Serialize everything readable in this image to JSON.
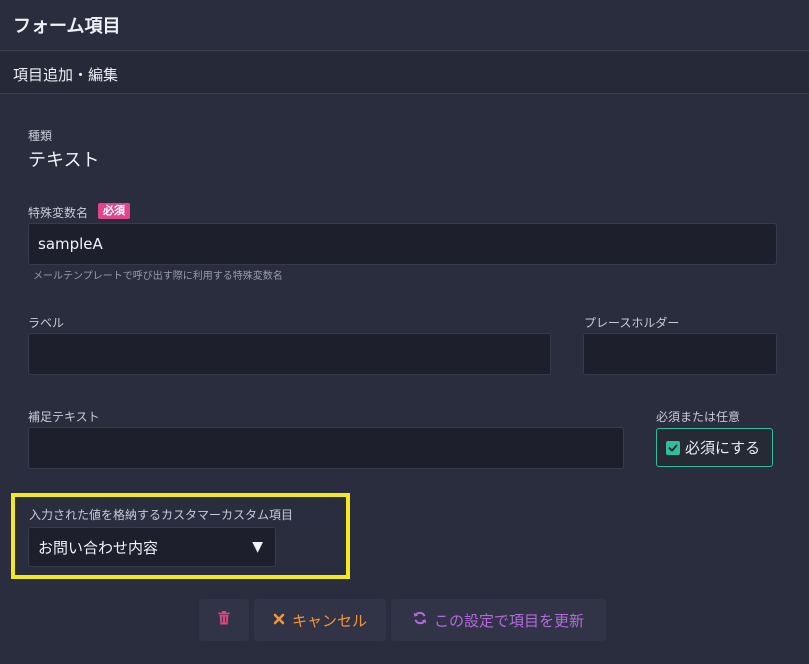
{
  "header": {
    "title": "フォーム項目"
  },
  "subheader": {
    "title": "項目追加・編集"
  },
  "type_field": {
    "label": "種類",
    "value": "テキスト"
  },
  "variable_field": {
    "label": "特殊変数名",
    "required_badge": "必須",
    "value": "sampleA",
    "hint": "メールテンプレートで呼び出す際に利用する特殊変数名"
  },
  "label_field": {
    "label": "ラベル",
    "value": ""
  },
  "placeholder_field": {
    "label": "プレースホルダー",
    "value": ""
  },
  "supplement_field": {
    "label": "補足テキスト",
    "value": ""
  },
  "required_toggle": {
    "label": "必須または任意",
    "button_label": "必須にする",
    "checked": true
  },
  "custom_field": {
    "label": "入力された値を格納するカスタマーカスタム項目",
    "selected": "お問い合わせ内容"
  },
  "actions": {
    "cancel_label": "キャンセル",
    "update_label": "この設定で項目を更新"
  },
  "colors": {
    "accent_green": "#2fbf9a",
    "badge_pink": "#e0468e",
    "cancel_orange": "#f3953a",
    "update_purple": "#b36bdb",
    "delete_red": "#e0467a",
    "highlight_yellow": "#f2ea1c"
  },
  "icons": {
    "delete": "trash-icon",
    "cancel": "times-icon",
    "update": "refresh-icon",
    "checkbox": "check-square-icon",
    "select": "caret-down-icon"
  }
}
